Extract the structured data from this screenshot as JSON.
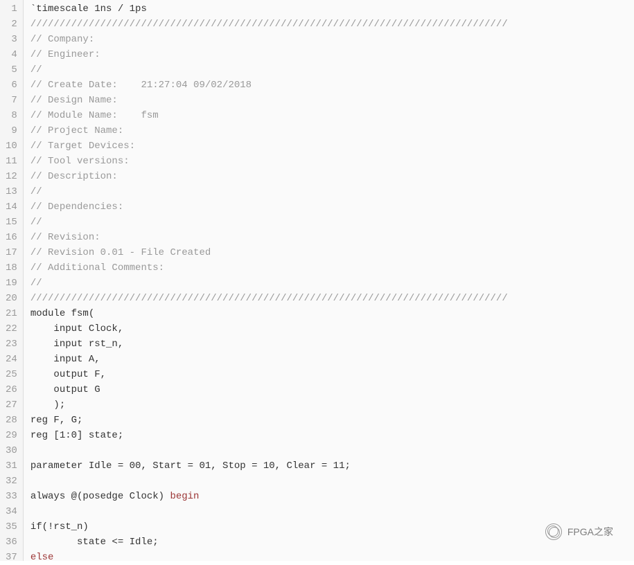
{
  "lines": [
    {
      "n": 1,
      "tokens": [
        {
          "t": "`timescale 1ns / 1ps",
          "c": "tk-normal"
        }
      ]
    },
    {
      "n": 2,
      "tokens": [
        {
          "t": "//////////////////////////////////////////////////////////////////////////////////",
          "c": "tk-comment"
        }
      ]
    },
    {
      "n": 3,
      "tokens": [
        {
          "t": "// Company: ",
          "c": "tk-comment"
        }
      ]
    },
    {
      "n": 4,
      "tokens": [
        {
          "t": "// Engineer: ",
          "c": "tk-comment"
        }
      ]
    },
    {
      "n": 5,
      "tokens": [
        {
          "t": "// ",
          "c": "tk-comment"
        }
      ]
    },
    {
      "n": 6,
      "tokens": [
        {
          "t": "// Create Date:    21:27:04 09/02/2018 ",
          "c": "tk-comment"
        }
      ]
    },
    {
      "n": 7,
      "tokens": [
        {
          "t": "// Design Name: ",
          "c": "tk-comment"
        }
      ]
    },
    {
      "n": 8,
      "tokens": [
        {
          "t": "// Module Name:    fsm ",
          "c": "tk-comment"
        }
      ]
    },
    {
      "n": 9,
      "tokens": [
        {
          "t": "// Project Name: ",
          "c": "tk-comment"
        }
      ]
    },
    {
      "n": 10,
      "tokens": [
        {
          "t": "// Target Devices: ",
          "c": "tk-comment"
        }
      ]
    },
    {
      "n": 11,
      "tokens": [
        {
          "t": "// Tool versions: ",
          "c": "tk-comment"
        }
      ]
    },
    {
      "n": 12,
      "tokens": [
        {
          "t": "// Description: ",
          "c": "tk-comment"
        }
      ]
    },
    {
      "n": 13,
      "tokens": [
        {
          "t": "//",
          "c": "tk-comment"
        }
      ]
    },
    {
      "n": 14,
      "tokens": [
        {
          "t": "// Dependencies: ",
          "c": "tk-comment"
        }
      ]
    },
    {
      "n": 15,
      "tokens": [
        {
          "t": "//",
          "c": "tk-comment"
        }
      ]
    },
    {
      "n": 16,
      "tokens": [
        {
          "t": "// Revision: ",
          "c": "tk-comment"
        }
      ]
    },
    {
      "n": 17,
      "tokens": [
        {
          "t": "// Revision 0.01 - File Created",
          "c": "tk-comment"
        }
      ]
    },
    {
      "n": 18,
      "tokens": [
        {
          "t": "// Additional Comments: ",
          "c": "tk-comment"
        }
      ]
    },
    {
      "n": 19,
      "tokens": [
        {
          "t": "//",
          "c": "tk-comment"
        }
      ]
    },
    {
      "n": 20,
      "tokens": [
        {
          "t": "//////////////////////////////////////////////////////////////////////////////////",
          "c": "tk-comment"
        }
      ]
    },
    {
      "n": 21,
      "tokens": [
        {
          "t": "module fsm(",
          "c": "tk-normal"
        }
      ]
    },
    {
      "n": 22,
      "tokens": [
        {
          "t": "    input Clock,",
          "c": "tk-normal"
        }
      ]
    },
    {
      "n": 23,
      "tokens": [
        {
          "t": "    input rst_n,",
          "c": "tk-normal"
        }
      ]
    },
    {
      "n": 24,
      "tokens": [
        {
          "t": "    input A,",
          "c": "tk-normal"
        }
      ]
    },
    {
      "n": 25,
      "tokens": [
        {
          "t": "    output F,",
          "c": "tk-normal"
        }
      ]
    },
    {
      "n": 26,
      "tokens": [
        {
          "t": "    output G",
          "c": "tk-normal"
        }
      ]
    },
    {
      "n": 27,
      "tokens": [
        {
          "t": "    );",
          "c": "tk-normal"
        }
      ]
    },
    {
      "n": 28,
      "tokens": [
        {
          "t": "reg F, G;",
          "c": "tk-normal"
        }
      ]
    },
    {
      "n": 29,
      "tokens": [
        {
          "t": "reg [1:0] state;",
          "c": "tk-normal"
        }
      ]
    },
    {
      "n": 30,
      "tokens": [
        {
          "t": "",
          "c": "tk-normal"
        }
      ]
    },
    {
      "n": 31,
      "tokens": [
        {
          "t": "parameter Idle = 00, Start = 01, Stop = 10, Clear = 11;",
          "c": "tk-normal"
        }
      ]
    },
    {
      "n": 32,
      "tokens": [
        {
          "t": "",
          "c": "tk-normal"
        }
      ]
    },
    {
      "n": 33,
      "tokens": [
        {
          "t": "always @(posedge Clock) ",
          "c": "tk-normal"
        },
        {
          "t": "begin",
          "c": "tk-keyword"
        }
      ]
    },
    {
      "n": 34,
      "tokens": [
        {
          "t": "",
          "c": "tk-normal"
        }
      ]
    },
    {
      "n": 35,
      "tokens": [
        {
          "t": "if(!rst_n)",
          "c": "tk-normal"
        }
      ]
    },
    {
      "n": 36,
      "tokens": [
        {
          "t": "        state <= Idle;",
          "c": "tk-normal"
        }
      ]
    },
    {
      "n": 37,
      "tokens": [
        {
          "t": "else",
          "c": "tk-keyword"
        }
      ]
    }
  ],
  "watermark_text": "FPGA之家"
}
